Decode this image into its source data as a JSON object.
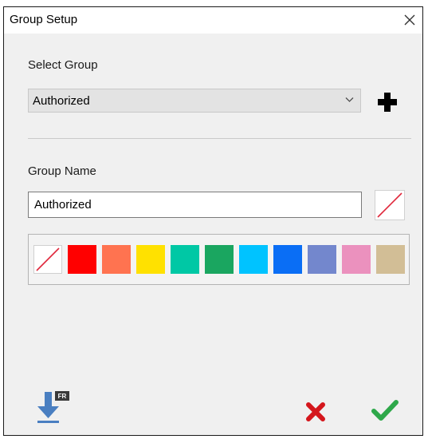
{
  "window": {
    "title": "Group Setup"
  },
  "select_group": {
    "label": "Select Group",
    "selected_value": "Authorized"
  },
  "group_name": {
    "label": "Group Name",
    "value": "Authorized"
  },
  "palette": {
    "swatches": [
      {
        "name": "no-color",
        "color": "none"
      },
      {
        "name": "red",
        "color": "#ff0000"
      },
      {
        "name": "salmon",
        "color": "#ff7350"
      },
      {
        "name": "yellow",
        "color": "#ffe100"
      },
      {
        "name": "teal",
        "color": "#00c8a5"
      },
      {
        "name": "green",
        "color": "#1aa660"
      },
      {
        "name": "sky-blue",
        "color": "#00c3ff"
      },
      {
        "name": "blue",
        "color": "#0a6ef5"
      },
      {
        "name": "slate-blue",
        "color": "#7387cd"
      },
      {
        "name": "pink",
        "color": "#eb91be"
      },
      {
        "name": "tan",
        "color": "#d2be96"
      }
    ]
  },
  "footer": {
    "import_badge": "FR"
  },
  "colors": {
    "cancel": "#d4161c",
    "confirm": "#2ea84a",
    "download": "#4a7fc1"
  }
}
